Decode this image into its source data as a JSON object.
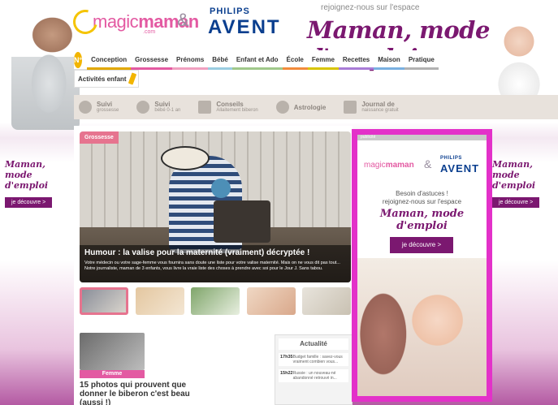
{
  "header": {
    "brand_magic": "magic",
    "brand_maman": "maman",
    "brand_com": ".com",
    "ampersand": "&",
    "philips": "PHILIPS",
    "avent": "AVENT",
    "join_text": "rejoignez-nous sur l'espace",
    "script_title": "Maman, mode d'emploi"
  },
  "nav": {
    "home_label": "N°",
    "items": [
      "Conception",
      "Grossesse",
      "Prénoms",
      "Bébé",
      "Enfant et Ado",
      "École",
      "Femme",
      "Recettes",
      "Maison",
      "Pratique"
    ],
    "sub_item": "Activités enfant"
  },
  "tools": [
    {
      "line1": "Suivi",
      "line2": "grossesse"
    },
    {
      "line1": "Suivi",
      "line2": "bébé 0-1 an"
    },
    {
      "line1": "Conseils",
      "line2": "Allaitement biberon"
    },
    {
      "line1": "Astrologie",
      "line2": ""
    },
    {
      "line1": "Journal de",
      "line2": "naissance gratuit"
    }
  ],
  "side_ad": {
    "script_line1": "Maman,",
    "script_line2": "mode d'emploi",
    "button": "je découvre >"
  },
  "hero": {
    "badge": "Grossesse",
    "title": "Humour : la valise pour la maternité (vraiment) décryptée !",
    "summary": "Votre médecin ou votre sage-femme vous fournira sans doute une liste pour votre valise maternité. Mais on ne vous dit pas tout... Notre journaliste, maman de 3 enfants, vous livre la vraie liste des choses à prendre avec soi pour le Jour J. Sans tabou."
  },
  "article": {
    "tag": "Femme",
    "title": "15 photos qui prouvent que donner le biberon c'est beau (aussi !)"
  },
  "news": {
    "heading": "Actualité",
    "items": [
      {
        "time": "17h35",
        "text": "Budget famille : savez-vous vraiment combien vous..."
      },
      {
        "time": "15h22",
        "text": "Russie : un nouveau-né abandonné retrouvé in..."
      }
    ]
  },
  "ad_panel": {
    "top_strip": "publicité",
    "mm_magic": "magic",
    "mm_maman": "maman",
    "ampersand": "&",
    "philips": "PHILIPS",
    "avent": "AVENT",
    "text_line1": "Besoin d'astuces !",
    "text_line2": "rejoignez-nous sur l'espace",
    "script": "Maman, mode d'emploi",
    "button": "je découvre >"
  },
  "colors": {
    "brand_pink": "#e35aa2",
    "brand_purple": "#7b1870",
    "ad_border": "#e331c9",
    "philips_blue": "#0b3f8f"
  }
}
